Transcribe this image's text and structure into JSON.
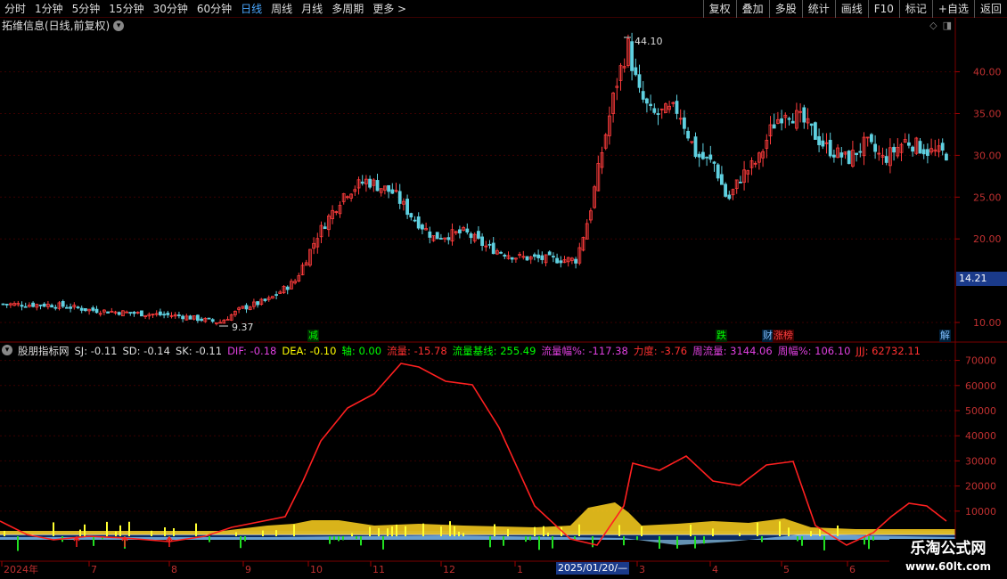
{
  "toolbar": {
    "periods": [
      "分时",
      "1分钟",
      "5分钟",
      "15分钟",
      "30分钟",
      "60分钟",
      "日线",
      "周线",
      "月线",
      "多周期",
      "更多 >"
    ],
    "active_period": "日线",
    "tools": [
      "复权",
      "叠加",
      "多股",
      "统计",
      "画线",
      "F10",
      "标记",
      "+自选",
      "返回"
    ]
  },
  "main_panel": {
    "title": "拓维信息(日线,前复权)",
    "high_label": "44.10",
    "low_label": "9.37",
    "current_price": "14.21",
    "y_labels": [
      "40.00",
      "35.00",
      "30.00",
      "25.00",
      "20.00",
      "10.00"
    ],
    "events": [
      {
        "text": "减",
        "color": "#00ff00"
      },
      {
        "text": "跌",
        "color": "#00ff00"
      },
      {
        "text": "财",
        "color": "#7fbfff"
      },
      {
        "text": "涨榜",
        "color": "#ff4040"
      },
      {
        "text": "解",
        "color": "#7fbfff"
      }
    ]
  },
  "indicator_panel": {
    "name": "股朋指标网",
    "values": [
      {
        "text": "SJ: -0.11",
        "color": "#dddddd"
      },
      {
        "text": "SD: -0.14",
        "color": "#dddddd"
      },
      {
        "text": "SK: -0.11",
        "color": "#dddddd"
      },
      {
        "text": "DIF: -0.18",
        "color": "#e040e0"
      },
      {
        "text": "DEA: -0.10",
        "color": "#ffff00"
      },
      {
        "text": "轴: 0.00",
        "color": "#00ff00"
      },
      {
        "text": "流量: -15.78",
        "color": "#ff3030"
      },
      {
        "text": "流量基线: 255.49",
        "color": "#00ff00"
      },
      {
        "text": "流量幅%: -117.38",
        "color": "#e040e0"
      },
      {
        "text": "力度: -3.76",
        "color": "#ff3030"
      },
      {
        "text": "周流量: 3144.06",
        "color": "#e040e0"
      },
      {
        "text": "周幅%: 106.10",
        "color": "#e040e0"
      },
      {
        "text": "JJJ: 62732.11",
        "color": "#ff3030"
      }
    ],
    "y_labels": [
      "70000",
      "60000",
      "50000",
      "40000",
      "30000",
      "20000",
      "10000"
    ]
  },
  "x_axis": {
    "labels": [
      "2024年",
      "7",
      "8",
      "9",
      "10",
      "11",
      "12",
      "1",
      "3",
      "4",
      "5",
      "6"
    ],
    "cursor_date": "2025/01/20/—"
  },
  "watermark": {
    "line1": "乐淘公式网",
    "line2": "www.60lt.com"
  }
}
